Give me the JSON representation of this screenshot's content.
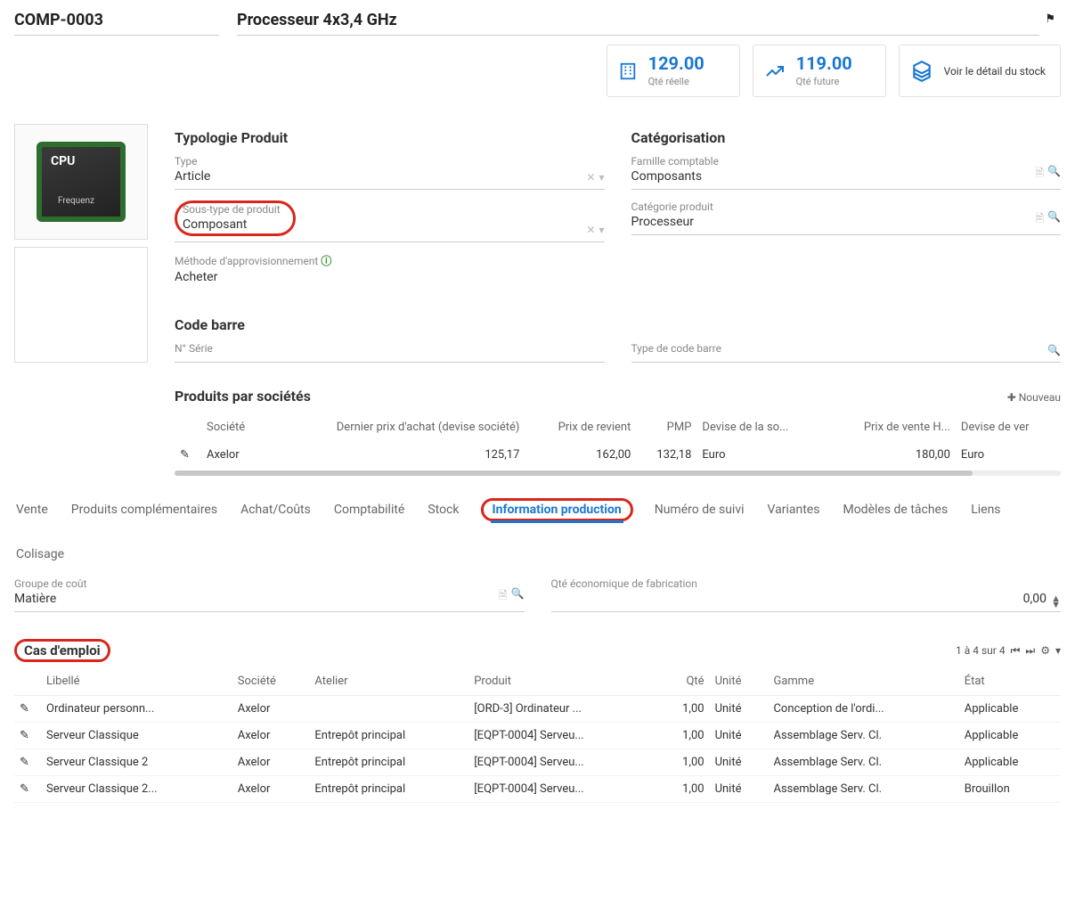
{
  "header": {
    "code": "COMP-0003",
    "title": "Processeur 4x3,4 GHz"
  },
  "stats": {
    "real_qty": {
      "value": "129.00",
      "label": "Qté réelle"
    },
    "future_qty": {
      "value": "119.00",
      "label": "Qté future"
    },
    "stock_link": "Voir le détail du stock"
  },
  "typology": {
    "title": "Typologie Produit",
    "type_label": "Type",
    "type_value": "Article",
    "subtype_label": "Sous-type de produit",
    "subtype_value": "Composant",
    "supply_label": "Méthode d'approvisionnement",
    "supply_value": "Acheter"
  },
  "categorization": {
    "title": "Catégorisation",
    "family_label": "Famille comptable",
    "family_value": "Composants",
    "category_label": "Catégorie produit",
    "category_value": "Processeur"
  },
  "barcode": {
    "title": "Code barre",
    "serial_label": "N° Série",
    "serial_value": "",
    "type_label": "Type de code barre",
    "type_value": ""
  },
  "companies": {
    "title": "Produits par sociétés",
    "new_label": "Nouveau",
    "columns": [
      "Société",
      "Dernier prix d'achat (devise société)",
      "Prix de revient",
      "PMP",
      "Devise de la so...",
      "Prix de vente H...",
      "Devise de ver"
    ],
    "rows": [
      {
        "company": "Axelor",
        "last_purchase": "125,17",
        "cost": "162,00",
        "pmp": "132,18",
        "currency_comp": "Euro",
        "sale_price": "180,00",
        "currency_sale": "Euro"
      }
    ]
  },
  "tabs": {
    "list": [
      "Vente",
      "Produits complémentaires",
      "Achat/Coûts",
      "Comptabilité",
      "Stock",
      "Information production",
      "Numéro de suivi",
      "Variantes",
      "Modèles de tâches",
      "Liens",
      "Colisage"
    ],
    "active_index": 5
  },
  "production": {
    "cost_group_label": "Groupe de coût",
    "cost_group_value": "Matière",
    "eco_qty_label": "Qté économique de fabrication",
    "eco_qty_value": "0,00"
  },
  "use_cases": {
    "title": "Cas d'emploi",
    "pager": "1 à 4 sur 4",
    "columns": [
      "Libellé",
      "Société",
      "Atelier",
      "Produit",
      "Qté",
      "Unité",
      "Gamme",
      "État"
    ],
    "rows": [
      {
        "label": "Ordinateur personn...",
        "company": "Axelor",
        "workshop": "",
        "product": "[ORD-3] Ordinateur ...",
        "qty": "1,00",
        "unit": "Unité",
        "routing": "Conception de l'ordi...",
        "state": "Applicable"
      },
      {
        "label": "Serveur Classique",
        "company": "Axelor",
        "workshop": "Entrepôt principal",
        "product": "[EQPT-0004] Serveu...",
        "qty": "1,00",
        "unit": "Unité",
        "routing": "Assemblage Serv. Cl.",
        "state": "Applicable"
      },
      {
        "label": "Serveur Classique 2",
        "company": "Axelor",
        "workshop": "Entrepôt principal",
        "product": "[EQPT-0004] Serveu...",
        "qty": "1,00",
        "unit": "Unité",
        "routing": "Assemblage Serv. Cl.",
        "state": "Applicable"
      },
      {
        "label": "Serveur Classique 2...",
        "company": "Axelor",
        "workshop": "Entrepôt principal",
        "product": "[EQPT-0004] Serveu...",
        "qty": "1,00",
        "unit": "Unité",
        "routing": "Assemblage Serv. Cl.",
        "state": "Brouillon"
      }
    ]
  }
}
